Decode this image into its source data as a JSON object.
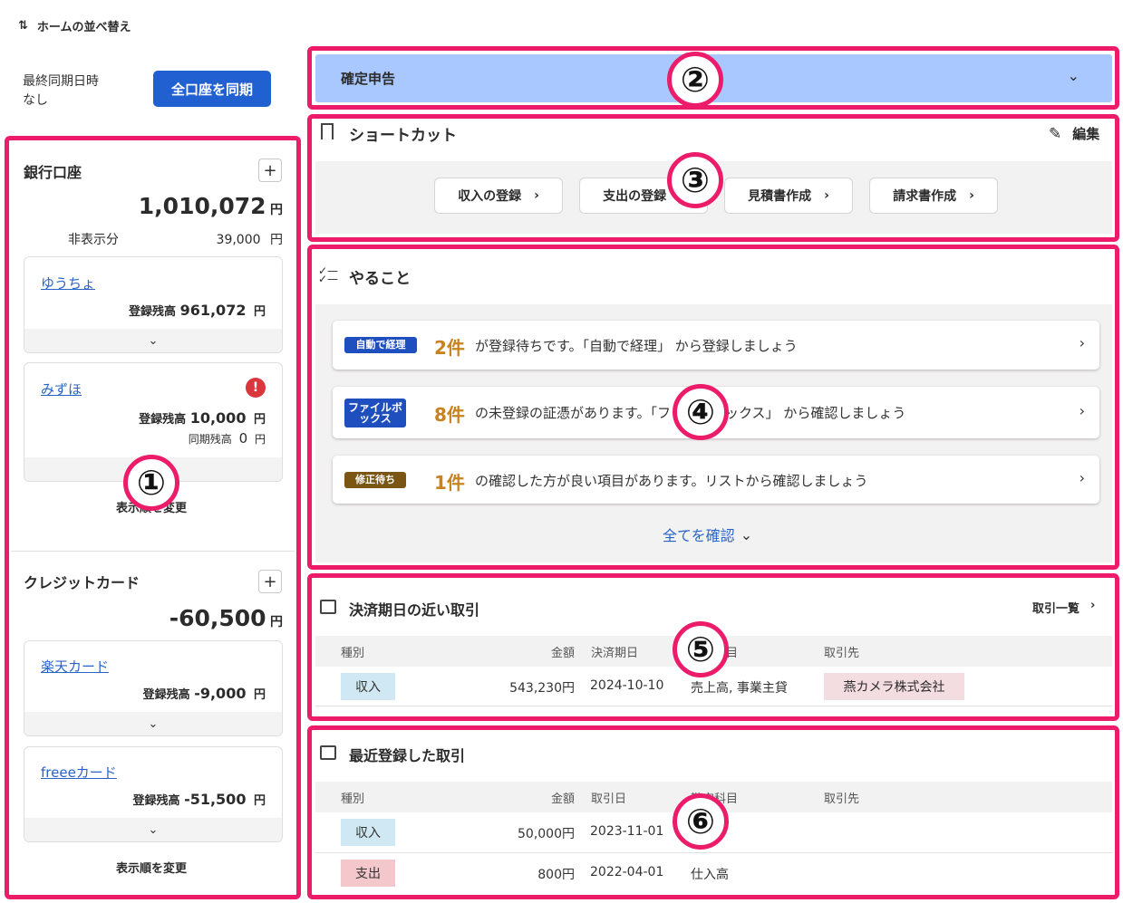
{
  "header": {
    "sort_label": "ホームの並べ替え",
    "sort_icon": "sort-arrows-icon"
  },
  "sync": {
    "label": "最終同期日時",
    "value": "なし",
    "button": "全口座を同期"
  },
  "bank": {
    "title": "銀行口座",
    "total": "1,010,072",
    "unit": "円",
    "hidden_label": "非表示分",
    "hidden_value": "39,000",
    "accounts": [
      {
        "name": "ゆうちょ",
        "reg_label": "登録残高",
        "reg_value": "961,072",
        "unit": "円"
      },
      {
        "name": "みずほ",
        "reg_label": "登録残高",
        "reg_value": "10,000",
        "unit": "円",
        "sync_label": "同期残高",
        "sync_value": "0"
      }
    ],
    "reorder": "表示順を変更"
  },
  "credit": {
    "title": "クレジットカード",
    "total": "-60,500",
    "unit": "円",
    "accounts": [
      {
        "name": "楽天カード",
        "reg_label": "登録残高",
        "reg_value": "-9,000",
        "unit": "円"
      },
      {
        "name": "freeeカード",
        "reg_label": "登録残高",
        "reg_value": "-51,500",
        "unit": "円"
      }
    ],
    "reorder": "表示順を変更"
  },
  "tax": {
    "title": "確定申告"
  },
  "shortcut": {
    "title": "ショートカット",
    "edit": "編集",
    "buttons": [
      "収入の登録",
      "支出の登録",
      "見積書作成",
      "請求書作成"
    ]
  },
  "todo": {
    "title": "やること",
    "items": [
      {
        "tag": "自動で経理",
        "tag_color": "#1f4fbf",
        "count": "2件",
        "text": "が登録待ちです。「自動で経理」 から登録しましょう"
      },
      {
        "tag": "ファイルボックス",
        "tag_color": "#1f4fbf",
        "count": "8件",
        "text": "の未登録の証憑があります。「ファイルボックス」 から確認しましょう"
      },
      {
        "tag": "修正待ち",
        "tag_color": "#7a5514",
        "count": "1件",
        "text": "の確認した方が良い項目があります。リストから確認しましょう"
      }
    ],
    "see_all": "全てを確認"
  },
  "due": {
    "title": "決済期日の近い取引",
    "list_link": "取引一覧",
    "headers": [
      "種別",
      "金額",
      "決済期日",
      "勘定科目",
      "取引先"
    ],
    "rows": [
      {
        "kind": "収入",
        "kind_color": "#cfe8f3",
        "amount": "543,230円",
        "date": "2024-10-10",
        "account": "売上高, 事業主貸",
        "partner": "燕カメラ株式会社"
      }
    ]
  },
  "recent": {
    "title": "最近登録した取引",
    "headers": [
      "種別",
      "金額",
      "取引日",
      "勘定科目",
      "取引先"
    ],
    "rows": [
      {
        "kind": "収入",
        "kind_color": "#cfe8f3",
        "amount": "50,000円",
        "date": "2023-11-01",
        "account": ""
      },
      {
        "kind": "支出",
        "kind_color": "#f4c7cc",
        "amount": "800円",
        "date": "2022-04-01",
        "account": "仕入高"
      }
    ]
  },
  "markers": [
    "①",
    "②",
    "③",
    "④",
    "⑤",
    "⑥"
  ],
  "colors": {
    "highlight": "#ec1c6b",
    "primary": "#2060d0",
    "tax_bar": "#a8c8ff",
    "count": "#c8821e"
  }
}
